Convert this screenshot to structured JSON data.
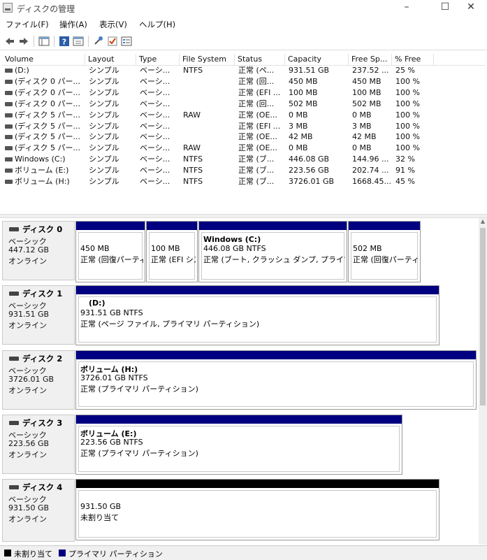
{
  "window": {
    "title": "ディスクの管理",
    "minimize": "–",
    "maximize": "☐",
    "close": "✕"
  },
  "menu": [
    "ファイル(F)",
    "操作(A)",
    "表示(V)",
    "ヘルプ(H)"
  ],
  "columns": [
    "Volume",
    "Layout",
    "Type",
    "File System",
    "Status",
    "Capacity",
    "Free Sp...",
    "% Free"
  ],
  "volumes": [
    [
      "(D:)",
      "シンプル",
      "ベーシ...",
      "NTFS",
      "正常 (ペ...",
      "931.51 GB",
      "237.52 ...",
      "25 %"
    ],
    [
      "(ディスク 0 パー...",
      "シンプル",
      "ベーシ...",
      "",
      "正常 (回...",
      "450 MB",
      "450 MB",
      "100 %"
    ],
    [
      "(ディスク 0 パー...",
      "シンプル",
      "ベーシ...",
      "",
      "正常 (EFI ...",
      "100 MB",
      "100 MB",
      "100 %"
    ],
    [
      "(ディスク 0 パー...",
      "シンプル",
      "ベーシ...",
      "",
      "正常 (回...",
      "502 MB",
      "502 MB",
      "100 %"
    ],
    [
      "(ディスク 5 パー...",
      "シンプル",
      "ベーシ...",
      "RAW",
      "正常 (OE...",
      "0 MB",
      "0 MB",
      "100 %"
    ],
    [
      "(ディスク 5 パー...",
      "シンプル",
      "ベーシ...",
      "",
      "正常 (EFI ...",
      "3 MB",
      "3 MB",
      "100 %"
    ],
    [
      "(ディスク 5 パー...",
      "シンプル",
      "ベーシ...",
      "",
      "正常 (OE...",
      "42 MB",
      "42 MB",
      "100 %"
    ],
    [
      "(ディスク 5 パー...",
      "シンプル",
      "ベーシ...",
      "RAW",
      "正常 (OE...",
      "0 MB",
      "0 MB",
      "100 %"
    ],
    [
      "Windows (C:)",
      "シンプル",
      "ベーシ...",
      "NTFS",
      "正常 (ブ...",
      "446.08 GB",
      "144.96 ...",
      "32 %"
    ],
    [
      "ボリューム (E:)",
      "シンプル",
      "ベーシ...",
      "NTFS",
      "正常 (ブ...",
      "223.56 GB",
      "202.74 ...",
      "91 %"
    ],
    [
      "ボリューム (H:)",
      "シンプル",
      "ベーシ...",
      "NTFS",
      "正常 (ブ...",
      "3726.01 GB",
      "1668.45...",
      "45 %"
    ]
  ],
  "disks": [
    {
      "name": "ディスク 0",
      "type": "ベーシック",
      "size": "447.12 GB",
      "status": "オンライン",
      "partitions": [
        {
          "title": "",
          "size": "450 MB",
          "status": "正常 (回復パーティション)"
        },
        {
          "title": "",
          "size": "100 MB",
          "status": "正常 (EFI システム パーティション)"
        },
        {
          "title": "Windows  (C:)",
          "size": "446.08 GB NTFS",
          "status": "正常 (ブート, クラッシュ ダンプ, プライマリ パーティション)"
        },
        {
          "title": "",
          "size": "502 MB",
          "status": "正常 (回復パーティション)"
        }
      ]
    },
    {
      "name": "ディスク 1",
      "type": "ベーシック",
      "size": "931.51 GB",
      "status": "オンライン",
      "partitions": [
        {
          "title": "(D:)",
          "size": "931.51 GB NTFS",
          "status": "正常 (ページ ファイル, プライマリ パーティション)"
        }
      ]
    },
    {
      "name": "ディスク 2",
      "type": "ベーシック",
      "size": "3726.01 GB",
      "status": "オンライン",
      "partitions": [
        {
          "title": "ボリューム  (H:)",
          "size": "3726.01 GB NTFS",
          "status": "正常 (プライマリ パーティション)"
        }
      ]
    },
    {
      "name": "ディスク 3",
      "type": "ベーシック",
      "size": "223.56 GB",
      "status": "オンライン",
      "partitions": [
        {
          "title": "ボリューム  (E:)",
          "size": "223.56 GB NTFS",
          "status": "正常 (プライマリ パーティション)"
        }
      ]
    },
    {
      "name": "ディスク 4",
      "type": "ベーシック",
      "size": "931.50 GB",
      "status": "オンライン",
      "partitions": [
        {
          "title": "",
          "size": "931.50 GB",
          "status": "未割り当て"
        }
      ]
    }
  ],
  "legend": {
    "unallocated": "未割り当て",
    "primary": "プライマリ パーティション",
    "unallocated_color": "#000000",
    "primary_color": "#000080"
  },
  "icons": [
    "back-arrow-icon",
    "forward-arrow-icon",
    "console-tree-icon",
    "help-icon",
    "properties-icon",
    "disk-icon"
  ]
}
